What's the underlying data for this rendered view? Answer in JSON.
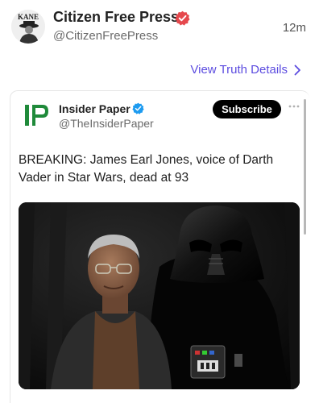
{
  "post": {
    "author_name": "Citizen Free Press",
    "author_handle": "@CitizenFreePress",
    "avatar_text": "KANE",
    "timestamp": "12m",
    "details_link": "View Truth Details"
  },
  "embed": {
    "logo_text": "IP",
    "source_name": "Insider Paper",
    "source_handle": "@TheInsiderPaper",
    "subscribe_label": "Subscribe",
    "headline": "BREAKING: James Earl Jones, voice of Darth Vader in Star Wars, dead at 93"
  },
  "colors": {
    "accent": "#5c4ce0",
    "verified_red": "#e5484d",
    "verified_blue": "#1d9bf0",
    "ip_green": "#1f8a3a"
  },
  "icons": [
    "verified-badge-icon",
    "chevron-right-icon",
    "more-options-icon",
    "ip-logo-icon"
  ]
}
